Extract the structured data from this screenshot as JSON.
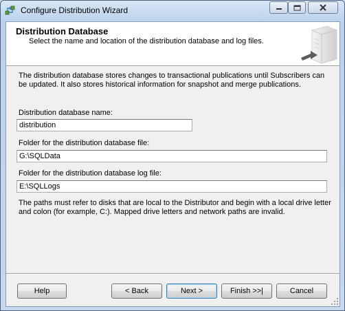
{
  "window": {
    "title": "Configure Distribution Wizard",
    "controls": [
      "minimize-icon",
      "maximize-icon",
      "close-icon"
    ]
  },
  "header": {
    "title": "Distribution Database",
    "subtitle": "Select the name and location of the distribution database and log files."
  },
  "body": {
    "intro": "The distribution database stores changes to transactional publications until Subscribers can be updated. It also stores historical information for snapshot and merge publications.",
    "db_name": {
      "label": "Distribution database name:",
      "value": "distribution"
    },
    "data_folder": {
      "label": "Folder for the distribution database file:",
      "value": "G:\\SQLData"
    },
    "log_folder": {
      "label": "Folder for the distribution database log file:",
      "value": "E:\\SQLLogs"
    },
    "note": "The paths must refer to disks that are local to the Distributor and begin with a local drive letter and colon (for example, C:). Mapped drive letters and network paths are invalid."
  },
  "buttons": {
    "help": "Help",
    "back": "< Back",
    "next": "Next >",
    "finish": "Finish >>|",
    "cancel": "Cancel"
  },
  "colors": {
    "accent": "#3c7fb1",
    "close_icon": "#c42b1c",
    "dialog_bg": "#f0f0f0"
  }
}
